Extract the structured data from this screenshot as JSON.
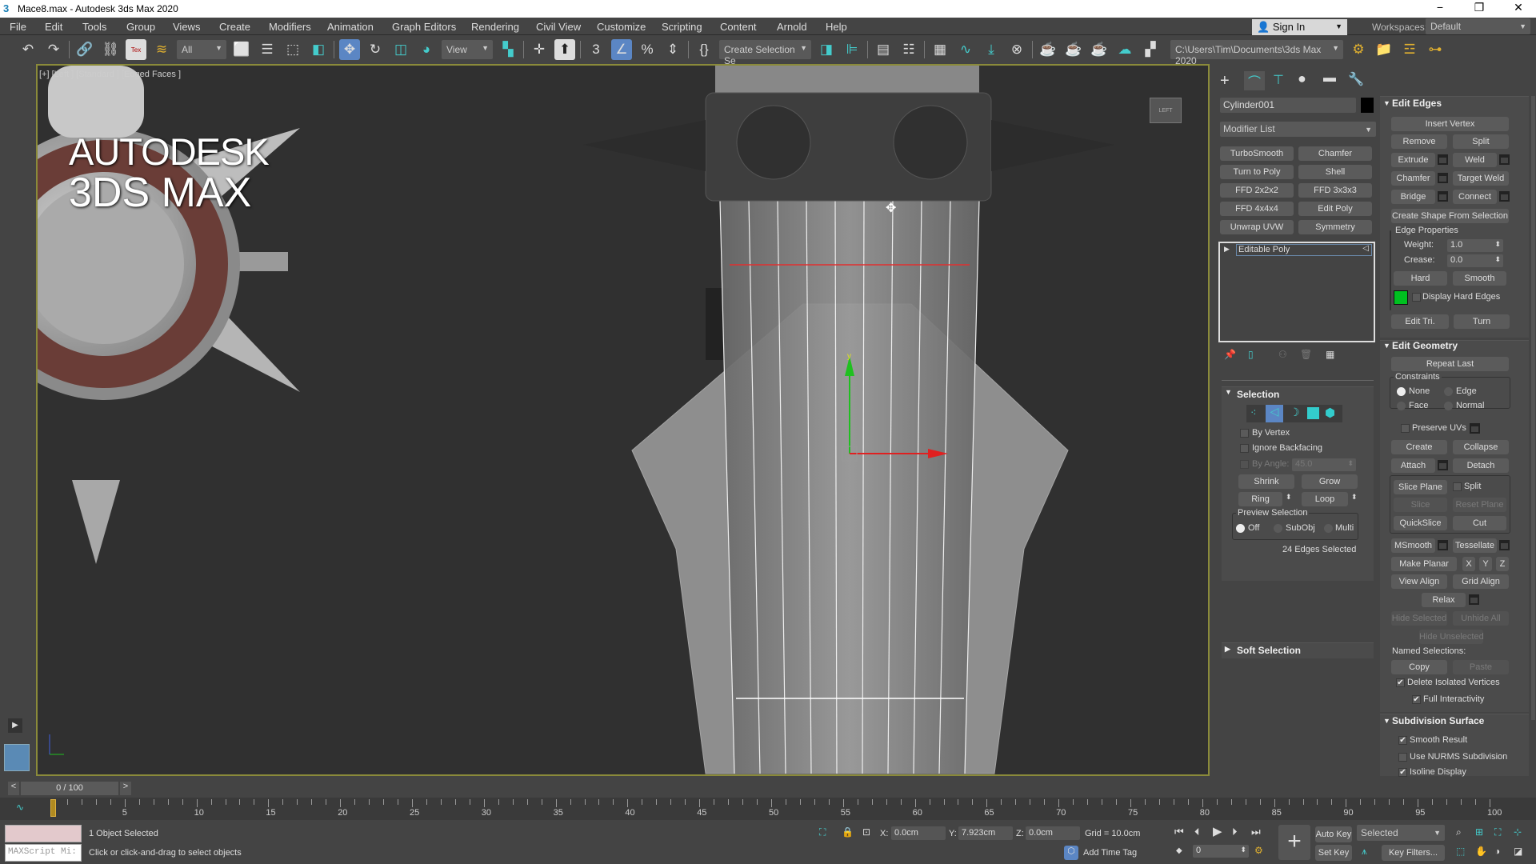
{
  "window": {
    "title": "Mace8.max - Autodesk 3ds Max 2020",
    "app_icon": "3"
  },
  "menu": [
    "File",
    "Edit",
    "Tools",
    "Group",
    "Views",
    "Create",
    "Modifiers",
    "Animation",
    "Graph Editors",
    "Rendering",
    "Civil View",
    "Customize",
    "Scripting",
    "Content",
    "Arnold",
    "Help"
  ],
  "account": {
    "sign_in": "Sign In",
    "workspaces_label": "Workspaces:",
    "workspace": "Default"
  },
  "toolbar": {
    "selection_filter": "All",
    "reference_coord": "View",
    "named_selection": "Create Selection Se",
    "project_path": "C:\\Users\\Tim\\Documents\\3ds Max 2020"
  },
  "viewport": {
    "label": "[+] [Left ] [Standard ] [Edged Faces ]",
    "logo_line1": "AUTODESK",
    "logo_line2": "3DS MAX",
    "viewcube": "LEFT",
    "selection_color": "#e03030"
  },
  "command_panel": {
    "object_name": "Cylinder001",
    "object_color": "#000000",
    "modifier_list": "Modifier List",
    "modifier_buttons": [
      "TurboSmooth",
      "Chamfer",
      "Turn to Poly",
      "Shell",
      "FFD 2x2x2",
      "FFD 3x3x3",
      "FFD 4x4x4",
      "Edit Poly",
      "Unwrap UVW",
      "Symmetry"
    ],
    "stack": [
      "Editable Poly"
    ],
    "selection": {
      "title": "Selection",
      "by_vertex": "By Vertex",
      "ignore_backfacing": "Ignore Backfacing",
      "by_angle": "By Angle:",
      "by_angle_value": "45.0",
      "shrink": "Shrink",
      "grow": "Grow",
      "ring": "Ring",
      "loop": "Loop",
      "preview_title": "Preview Selection",
      "preview_options": [
        "Off",
        "SubObj",
        "Multi"
      ],
      "preview_selected": "Off",
      "status": "24 Edges Selected",
      "active_level": "edge"
    },
    "soft_selection": {
      "title": "Soft Selection"
    },
    "edit_edges": {
      "title": "Edit Edges",
      "insert_vertex": "Insert Vertex",
      "remove": "Remove",
      "split": "Split",
      "extrude": "Extrude",
      "weld": "Weld",
      "chamfer": "Chamfer",
      "target_weld": "Target Weld",
      "bridge": "Bridge",
      "connect": "Connect",
      "create_shape": "Create Shape From Selection",
      "edge_properties": "Edge Properties",
      "weight_label": "Weight:",
      "weight": "1.0",
      "crease_label": "Crease:",
      "crease": "0.0",
      "hard": "Hard",
      "smooth": "Smooth",
      "hard_edge_color": "#00c020",
      "display_hard_edges": "Display Hard Edges",
      "edit_tri": "Edit Tri.",
      "turn": "Turn"
    },
    "edit_geometry": {
      "title": "Edit Geometry",
      "repeat_last": "Repeat Last",
      "constraints": "Constraints",
      "constraint_options": [
        "None",
        "Edge",
        "Face",
        "Normal"
      ],
      "constraint_selected": "None",
      "preserve_uvs": "Preserve UVs",
      "create": "Create",
      "collapse": "Collapse",
      "attach": "Attach",
      "detach": "Detach",
      "slice_plane": "Slice Plane",
      "split": "Split",
      "slice": "Slice",
      "reset_plane": "Reset Plane",
      "quickslice": "QuickSlice",
      "cut": "Cut",
      "msmooth": "MSmooth",
      "tessellate": "Tessellate",
      "make_planar": "Make Planar",
      "x": "X",
      "y": "Y",
      "z": "Z",
      "view_align": "View Align",
      "grid_align": "Grid Align",
      "relax": "Relax",
      "hide_selected": "Hide Selected",
      "unhide_all": "Unhide All",
      "hide_unselected": "Hide Unselected",
      "named_selections": "Named Selections:",
      "copy": "Copy",
      "paste": "Paste",
      "delete_isolated": "Delete Isolated Vertices",
      "full_interactivity": "Full Interactivity"
    },
    "subdivision": {
      "title": "Subdivision Surface",
      "smooth_result": "Smooth Result",
      "use_nurms": "Use NURMS Subdivision",
      "isoline": "Isoline Display"
    }
  },
  "timeline": {
    "frame_display": "0 / 100",
    "current": 0,
    "end": 100,
    "tick_labels": [
      "0",
      "5",
      "10",
      "15",
      "20",
      "25",
      "30",
      "35",
      "40",
      "45",
      "50",
      "55",
      "60",
      "65",
      "70",
      "75",
      "80",
      "85",
      "90",
      "95",
      "100"
    ]
  },
  "status": {
    "maxscript": "MAXScript Mi:",
    "selected": "1 Object Selected",
    "prompt": "Click or click-and-drag to select objects",
    "x_label": "X:",
    "x": "0.0cm",
    "y_label": "Y:",
    "y": "7.923cm",
    "z_label": "Z:",
    "z": "0.0cm",
    "grid": "Grid = 10.0cm",
    "add_time_tag": "Add Time Tag",
    "auto_key": "Auto Key",
    "set_key": "Set Key",
    "key_mode": "Selected",
    "key_filters": "Key Filters...",
    "frame": "0"
  }
}
